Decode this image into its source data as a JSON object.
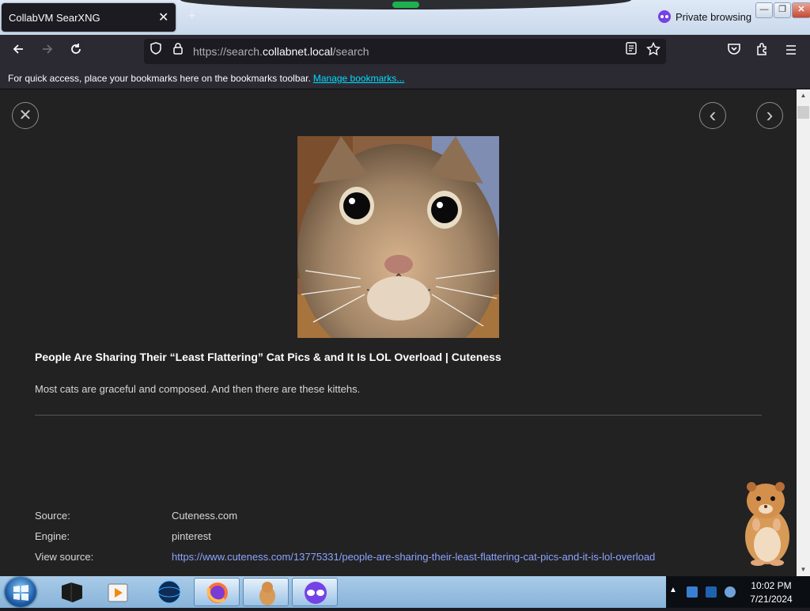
{
  "window": {
    "tab_title": "CollabVM SearXNG",
    "tab_close": "✕",
    "new_tab": "+",
    "private_label": "Private browsing",
    "minimize": "—",
    "restore": "❐",
    "close": "✕"
  },
  "navbar": {
    "url_prefix": "https://search.",
    "url_host": "collabnet.local",
    "url_path": "/search"
  },
  "bookmarks": {
    "text": "For quick access, place your bookmarks here on the bookmarks toolbar.",
    "manage_link": "Manage bookmarks..."
  },
  "detail": {
    "close": "✕",
    "prev": "‹",
    "next": "›",
    "title": "People Are Sharing Their “Least Flattering” Cat Pics & and It Is LOL Overload | Cuteness",
    "description": "Most cats are graceful and composed. And then there are these kittehs.",
    "source_label": "Source:",
    "source_value": "Cuteness.com",
    "engine_label": "Engine:",
    "engine_value": "pinterest",
    "view_source_label": "View source:",
    "view_source_url": "https://www.cuteness.com/13775331/people-are-sharing-their-least-flattering-cat-pics-and-it-is-lol-overload"
  },
  "taskbar": {
    "time": "10:02 PM",
    "date": "7/21/2024"
  },
  "colors": {
    "page_bg": "#222222",
    "link": "#8aa4ff",
    "accent": "#00ddff",
    "private": "#7542e5"
  }
}
